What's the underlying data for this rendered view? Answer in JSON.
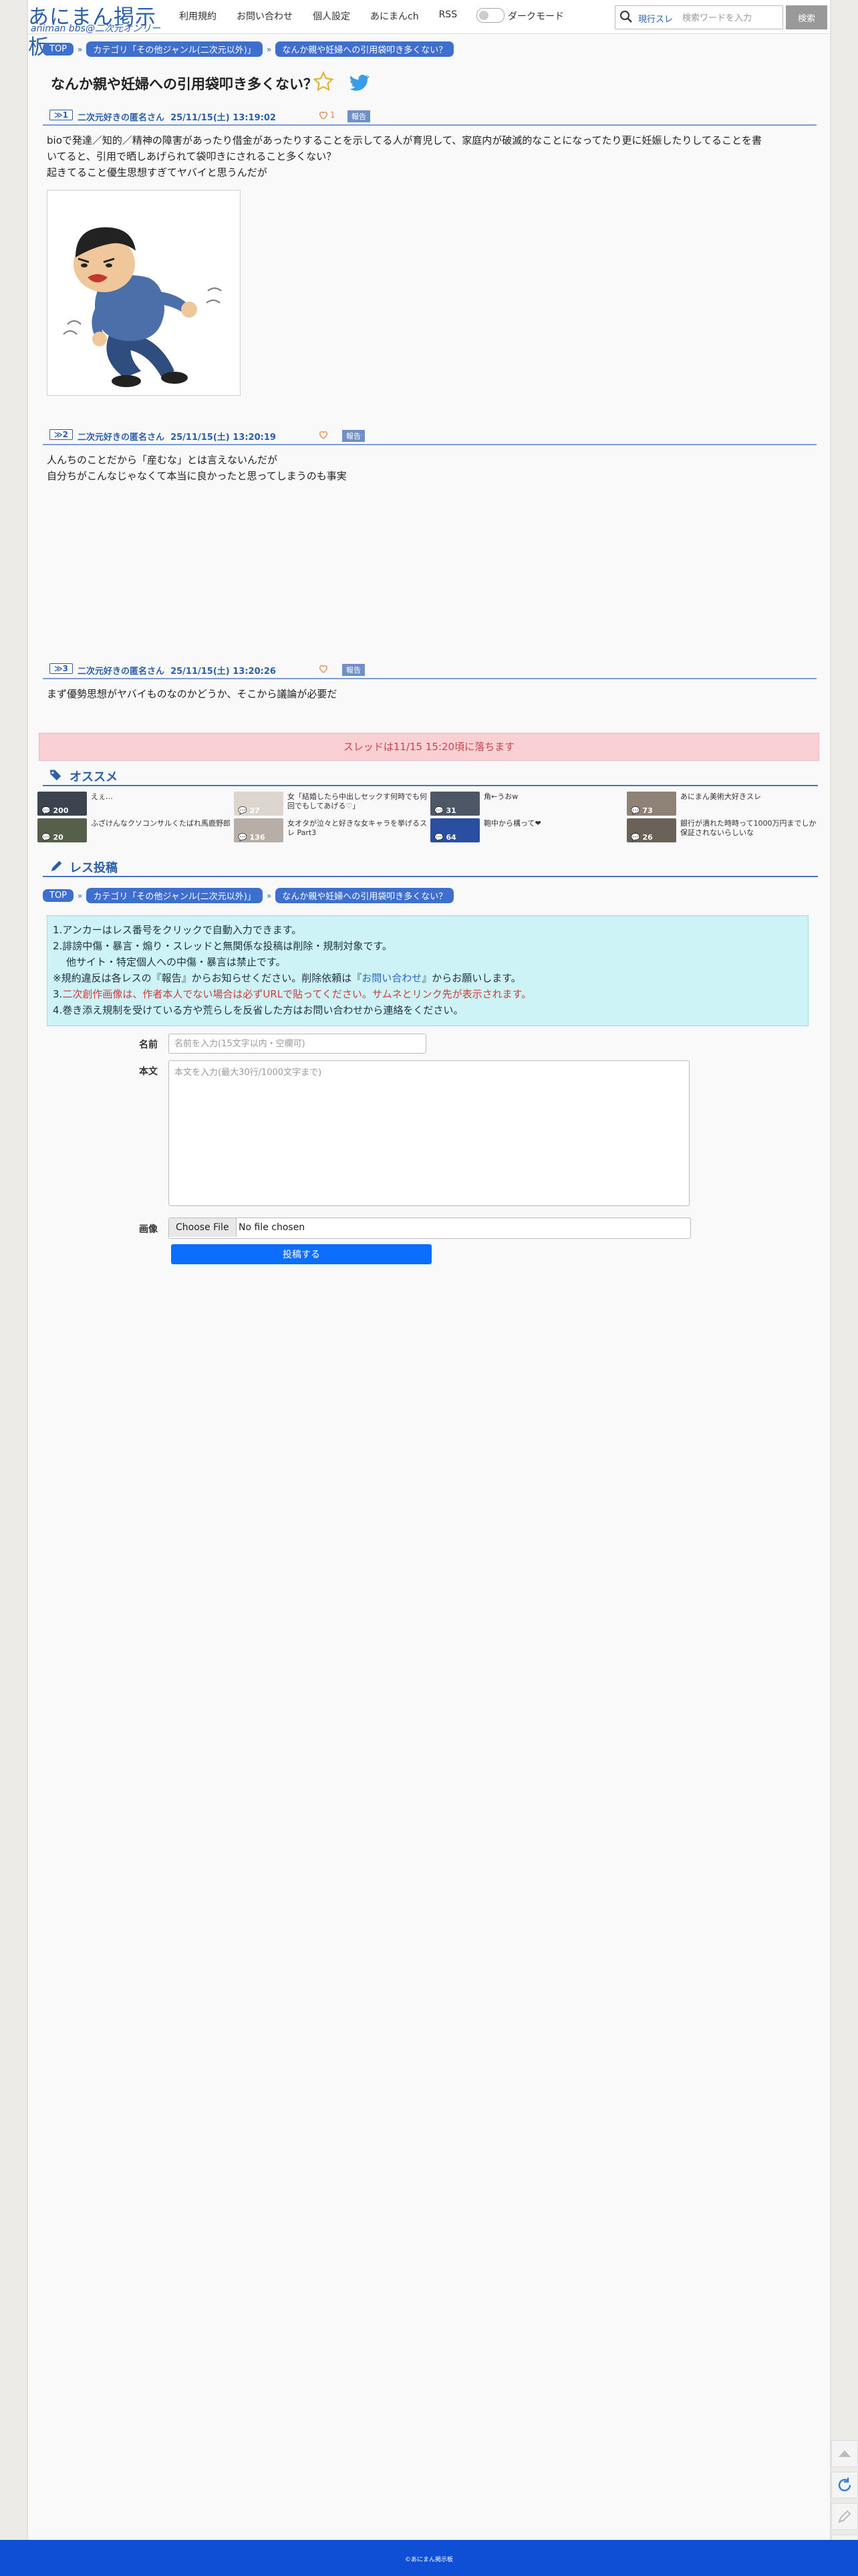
{
  "header": {
    "logo": "あにまん掲示板",
    "logo_sub": "animan bbs@二次元オンリー",
    "nav": [
      "利用規約",
      "お問い合わせ",
      "個人設定",
      "あにまんch",
      "RSS"
    ],
    "dark_mode_label": "ダークモード",
    "search_current": "現行スレ",
    "search_placeholder": "検索ワードを入力",
    "search_button": "検索"
  },
  "breadcrumb": {
    "items": [
      "TOP",
      "カテゴリ「その他ジャンル(二次元以外)」",
      "なんか親や妊婦への引用袋叩き多くない？"
    ]
  },
  "thread": {
    "title": "なんか親や妊婦への引用袋叩き多くない？"
  },
  "posts": [
    {
      "no": "≫1",
      "name": "二次元好きの匿名さん",
      "date": "25/11/15(土) 13:19:02",
      "likes": "1",
      "report": "報告",
      "lines": [
        "bioで発達／知的／精神の障害があったり借金があったりすることを示してる人が育児して、家庭内が破滅的なことになってたり更に妊娠したりしてることを書",
        "いてると、引用で晒しあげられて袋叩きにされること多くない？",
        "起きてること優生思想すぎてヤバイと思うんだが"
      ]
    },
    {
      "no": "≫2",
      "name": "二次元好きの匿名さん",
      "date": "25/11/15(土) 13:20:19",
      "report": "報告",
      "lines": [
        "人んちのことだから「産むな」とは言えないんだが",
        "自分ちがこんなじゃなくて本当に良かったと思ってしまうのも事実"
      ]
    },
    {
      "no": "≫3",
      "name": "二次元好きの匿名さん",
      "date": "25/11/15(土) 13:20:26",
      "report": "報告",
      "lines": [
        "まず優勢思想がヤバイものなのかどうか、そこから議論が必要だ"
      ]
    }
  ],
  "notice": "スレッドは11/15 15:20頃に落ちます",
  "recommend": {
    "title": "オススメ",
    "items": [
      {
        "count": "200",
        "text": "えぇ…",
        "color": "#3c4450"
      },
      {
        "count": "27",
        "text": "女「結婚したら中出しセックす何時でも何回でもしてあげる♡」",
        "color": "#dcd6cf"
      },
      {
        "count": "31",
        "text": "角←うおw",
        "color": "#4d5766"
      },
      {
        "count": "73",
        "text": "あにまん美術大好きスレ",
        "color": "#8d8275"
      },
      {
        "count": "20",
        "text": "ふざけんなクソコンサルくたばれ馬鹿野郎",
        "color": "#555f4a"
      },
      {
        "count": "136",
        "text": "女オタが泣々と好きな女キャラを挙げるスレ Part3",
        "color": "#b7aea7"
      },
      {
        "count": "64",
        "text": "鞄中から構って❤",
        "color": "#2a4fa0"
      },
      {
        "count": "26",
        "text": "銀行が潰れた時時って1000万円までしか保証されないらしいな",
        "color": "#6a6258"
      }
    ]
  },
  "reply": {
    "title": "レス投稿",
    "rules": {
      "line1": "1.アンカーはレス番号をクリックで自動入力できます。",
      "line2": "2.誹謗中傷・暴言・煽り・スレッドと無関係な投稿は削除・規制対象です。",
      "line3": "他サイト・特定個人への中傷・暴言は禁止です。",
      "line4_a": "※規約違反は各レスの『報告』からお知らせください。削除依頼は『",
      "line4_link": "お問い合わせ",
      "line4_b": "』からお願いします。",
      "line5_a": "3.",
      "line5_red": "二次創作画像は、作者本人でない場合は必ずURLで貼ってください。サムネとリンク先が表示されます。",
      "line6": "4.巻き添え規制を受けている方や荒らしを反省した方はお問い合わせから連絡をください。"
    },
    "name_label": "名前",
    "name_placeholder": "名前を入力(15文字以内・空欄可)",
    "body_label": "本文",
    "body_placeholder": "本文を入力(最大30行/1000文字まで)",
    "image_label": "画像",
    "file_button": "Choose File",
    "file_none": "No file chosen",
    "submit": "投稿する"
  },
  "footer": "©あにまん掲示板",
  "colors": {
    "brand": "#2b5fa8",
    "chip": "#3f6fce",
    "footer": "#0f4fd6",
    "submit": "#0d6efd"
  }
}
